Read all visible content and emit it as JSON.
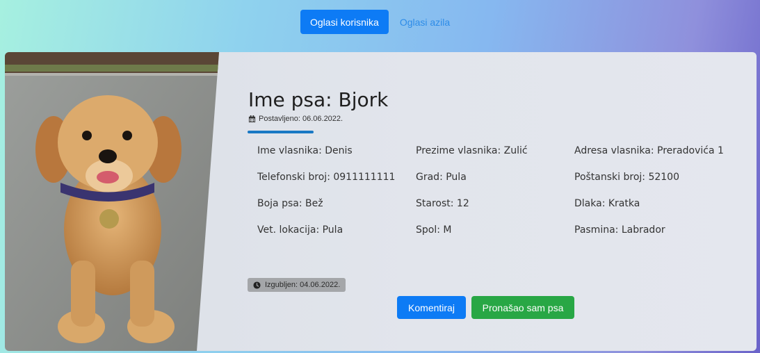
{
  "tabs": {
    "active_label": "Oglasi korisnika",
    "other_label": "Oglasi azila"
  },
  "dog": {
    "title": "Ime psa: Bjork",
    "posted": "Postavljeno: 06.06.2022.",
    "fields": {
      "owner_first": "Ime vlasnika: Denis",
      "owner_last": "Prezime vlasnika: Zulić",
      "address": "Adresa  vlasnika:  Preradovića 1",
      "phone": "Telefonski broj: 0911111111",
      "city": "Grad: Pula",
      "postal": "Poštanski broj: 52100",
      "color": "Boja psa: Bež",
      "age": "Starost: 12",
      "coat": "Dlaka: Kratka",
      "vet": "Vet. lokacija: Pula",
      "sex": "Spol: M",
      "breed": "Pasmina: Labrador"
    },
    "lost": "Izgubljen: 04.06.2022."
  },
  "buttons": {
    "comment": "Komentiraj",
    "found": "Pronašao sam psa"
  },
  "colors": {
    "primary": "#0d7bf5",
    "success": "#28a745",
    "accent_line": "#1978c4"
  },
  "icons": {
    "posted": "calendar-icon",
    "lost": "clock-icon"
  }
}
